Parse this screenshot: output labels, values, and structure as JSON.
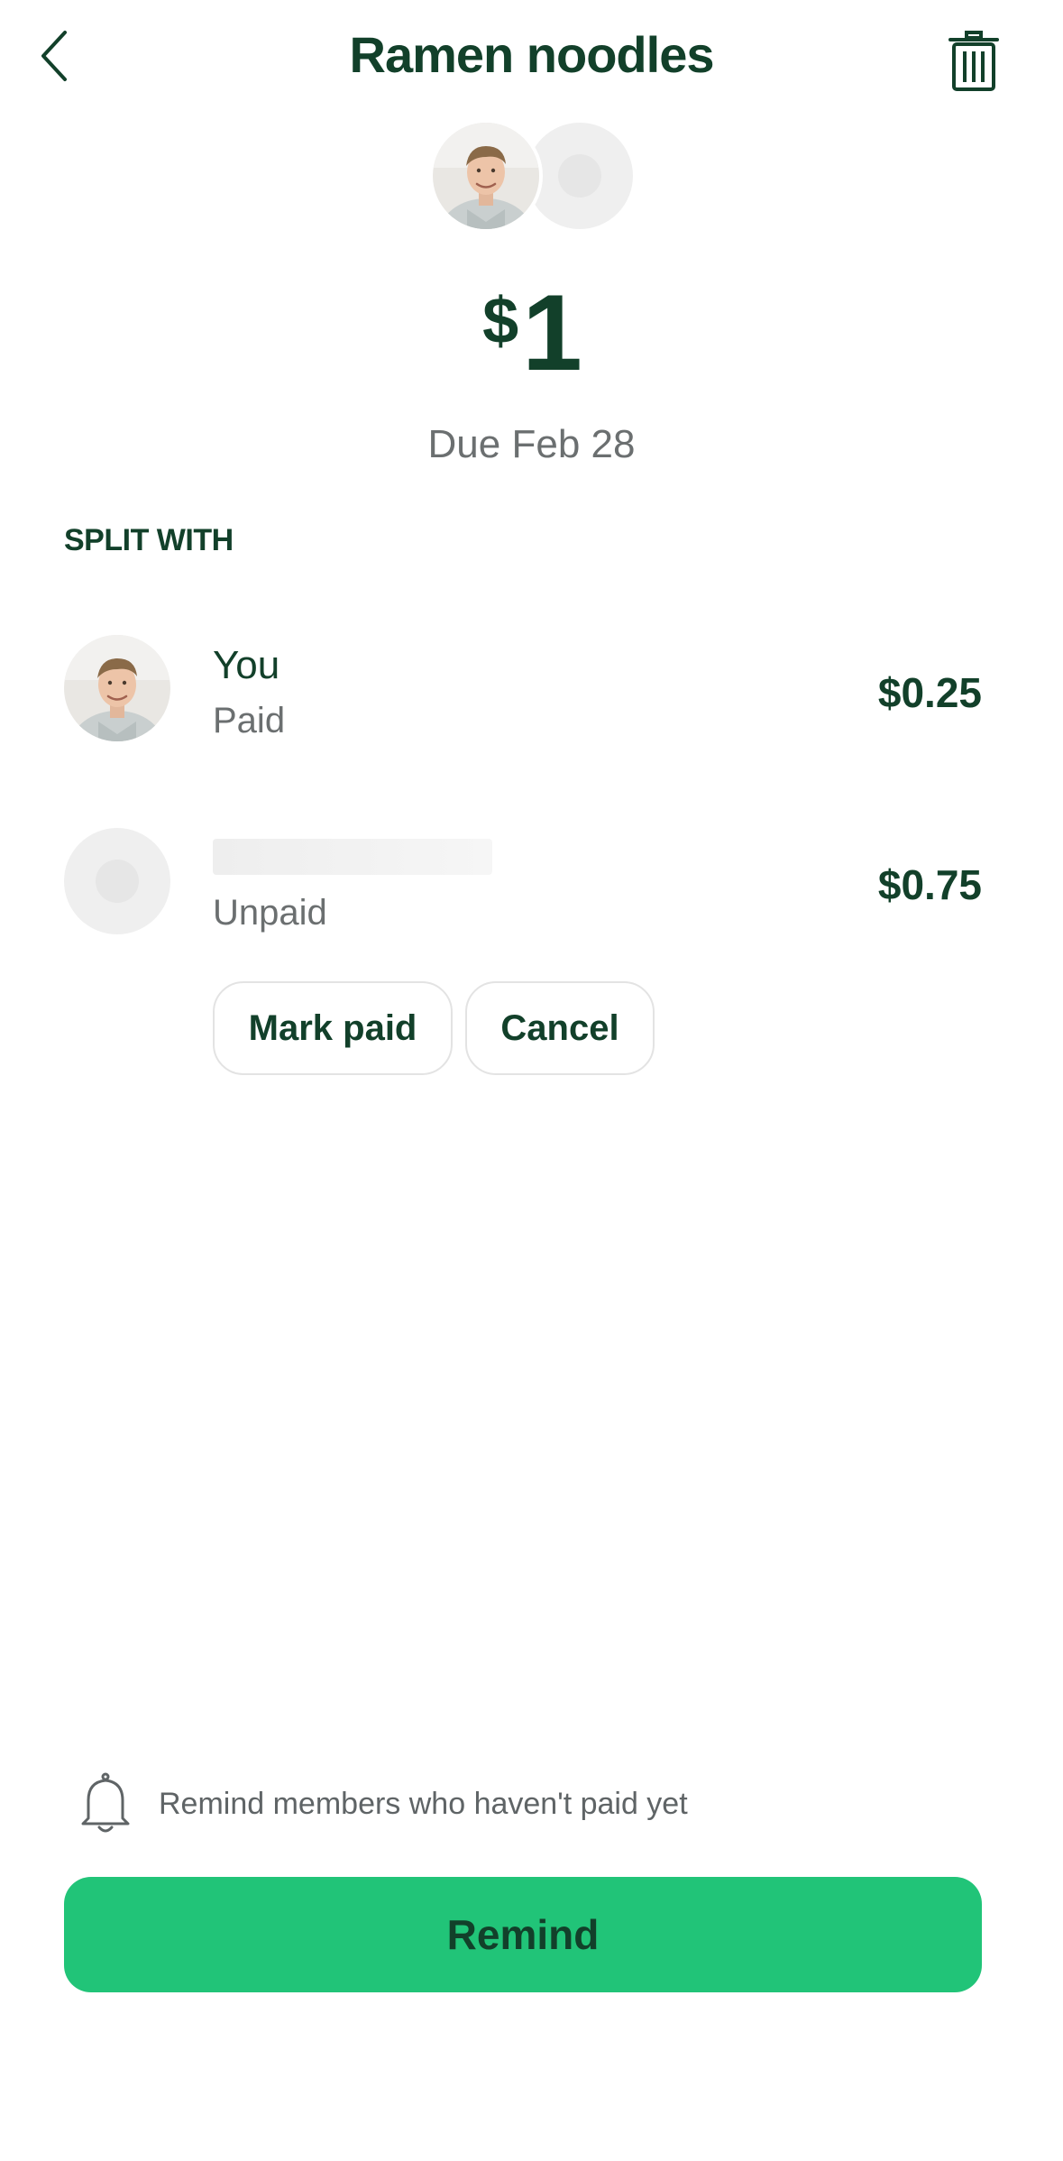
{
  "header": {
    "title": "Ramen noodles",
    "back_icon": "chevron-left-icon",
    "delete_icon": "trash-icon"
  },
  "summary": {
    "currency": "$",
    "amount": "1",
    "due": "Due Feb 28"
  },
  "split": {
    "label": "SPLIT WITH",
    "members": [
      {
        "name": "You",
        "status": "Paid",
        "amount": "$0.25"
      },
      {
        "name": "",
        "status": "Unpaid",
        "amount": "$0.75"
      }
    ],
    "actions": {
      "mark_paid": "Mark paid",
      "cancel": "Cancel"
    }
  },
  "footer": {
    "reminder_text": "Remind members who haven't paid yet",
    "reminder_icon": "bell-icon",
    "remind_button": "Remind"
  },
  "colors": {
    "primary_text": "#12402a",
    "secondary_text": "#6b6f70",
    "accent": "#21c478",
    "border": "#e3e3e3"
  }
}
